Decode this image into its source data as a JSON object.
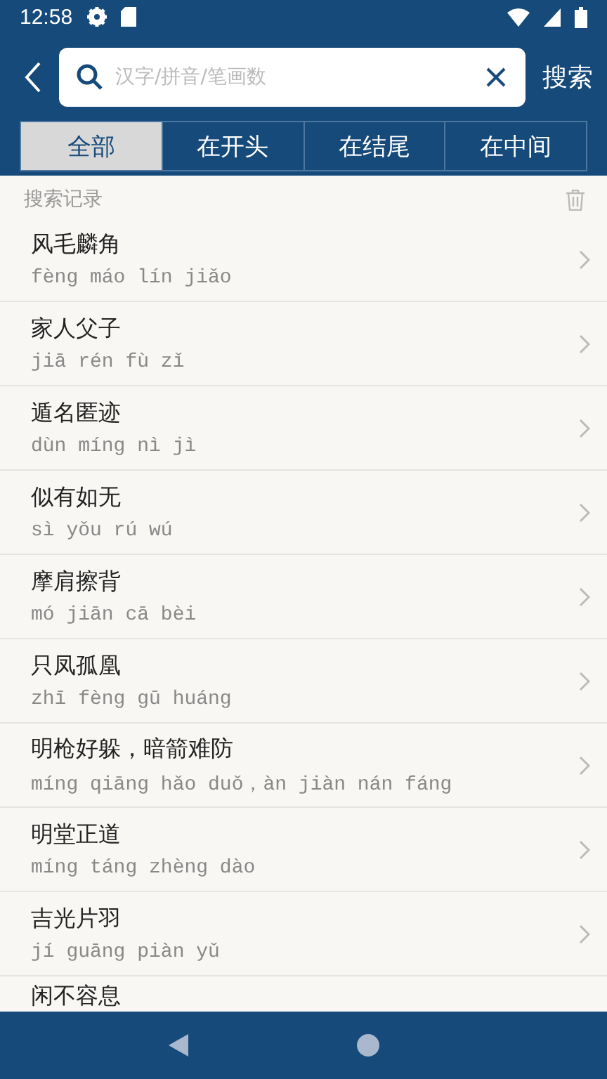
{
  "status_bar": {
    "time": "12:58"
  },
  "search": {
    "placeholder": "汉字/拼音/笔画数",
    "button": "搜索"
  },
  "tabs": [
    {
      "label": "全部",
      "selected": true
    },
    {
      "label": "在开头",
      "selected": false
    },
    {
      "label": "在结尾",
      "selected": false
    },
    {
      "label": "在中间",
      "selected": false
    }
  ],
  "history": {
    "title": "搜索记录",
    "items": [
      {
        "title": "风毛麟角",
        "pinyin": "fèng máo lín jiǎo"
      },
      {
        "title": "家人父子",
        "pinyin": "jiā rén fù zǐ"
      },
      {
        "title": "遁名匿迹",
        "pinyin": "dùn míng nì jì"
      },
      {
        "title": "似有如无",
        "pinyin": "sì yǒu rú wú"
      },
      {
        "title": "摩肩擦背",
        "pinyin": "mó jiān cā bèi"
      },
      {
        "title": "只凤孤凰",
        "pinyin": "zhī fèng gū huáng"
      },
      {
        "title": "明枪好躲，暗箭难防",
        "pinyin": "míng qiāng hǎo duǒ，àn jiàn nán fáng"
      },
      {
        "title": "明堂正道",
        "pinyin": "míng táng zhèng dào"
      },
      {
        "title": "吉光片羽",
        "pinyin": "jí guāng piàn yǔ"
      },
      {
        "title": "闲不容息"
      }
    ]
  }
}
